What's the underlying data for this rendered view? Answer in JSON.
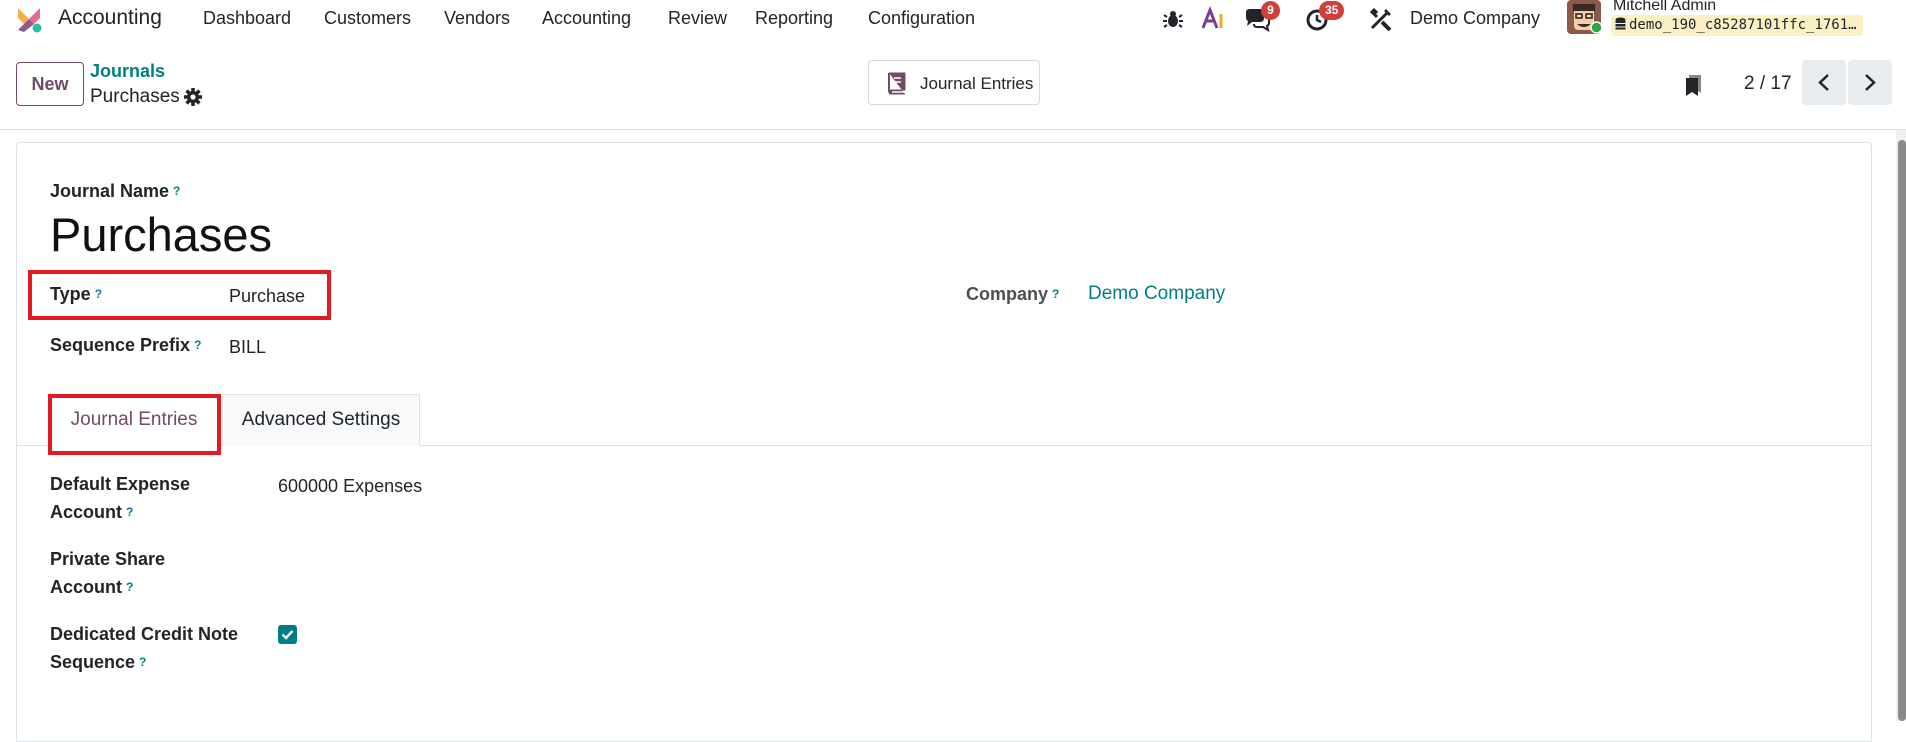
{
  "navbar": {
    "app_name": "Accounting",
    "menu": [
      "Dashboard",
      "Customers",
      "Vendors",
      "Accounting",
      "Review",
      "Reporting",
      "Configuration"
    ],
    "icons": [
      "bug-icon",
      "ai-icon",
      "messages-icon",
      "activity-clock-icon",
      "tools-icon"
    ],
    "messages_count": "9",
    "activities_count": "35",
    "company": "Demo Company",
    "user_name": "Mitchell Admin",
    "database": "demo_190_c85287101ffc_1761…"
  },
  "control_panel": {
    "new_label": "New",
    "breadcrumb_parent": "Journals",
    "breadcrumb_current": "Purchases",
    "smart_button_label": "Journal Entries",
    "pager": "2 / 17"
  },
  "form": {
    "journal_name_label": "Journal Name",
    "journal_name_value": "Purchases",
    "type_label": "Type",
    "type_value": "Purchase",
    "company_label": "Company",
    "company_value": "Demo Company",
    "sequence_prefix_label": "Sequence Prefix",
    "sequence_prefix_value": "BILL",
    "help_mark": "?",
    "tabs": [
      "Journal Entries",
      "Advanced Settings"
    ],
    "default_expense_label_1": "Default Expense",
    "default_expense_label_2": "Account",
    "default_expense_value": "600000 Expenses",
    "private_share_label_1": "Private Share",
    "private_share_label_2": "Account",
    "dedicated_credit_label_1": "Dedicated Credit Note",
    "dedicated_credit_label_2": "Sequence",
    "dedicated_credit_checked": true
  },
  "colors": {
    "brand": "#714b67",
    "link": "#017e84",
    "badge": "#d23f3a",
    "highlight": "#e01b24"
  }
}
